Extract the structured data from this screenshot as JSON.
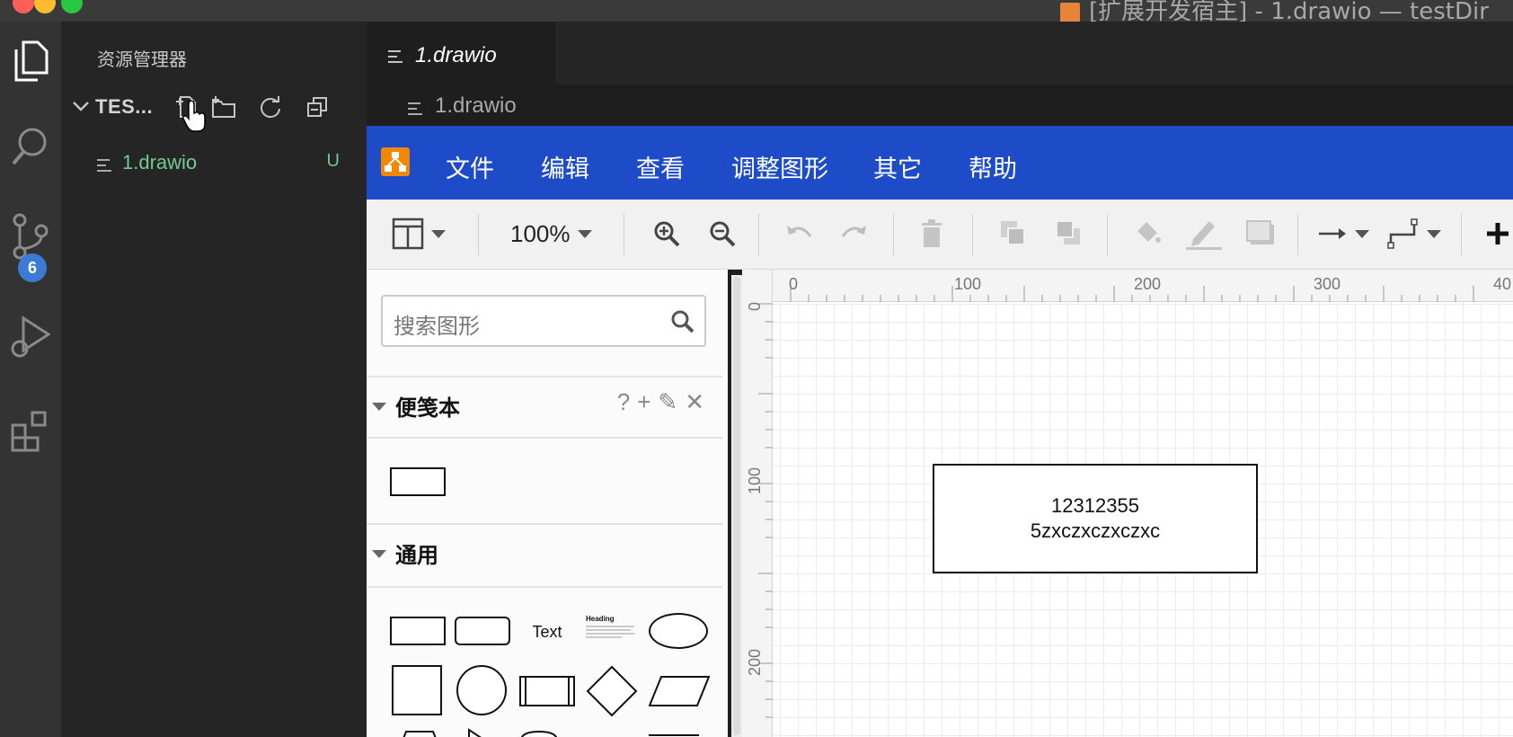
{
  "window": {
    "title": "[扩展开发宿主] - 1.drawio — testDir"
  },
  "activity_bar": {
    "scm_badge": "6"
  },
  "explorer": {
    "title": "资源管理器",
    "folder": "TES...",
    "files": [
      {
        "name": "1.drawio",
        "status": "U"
      }
    ]
  },
  "editor": {
    "active_tab": "1.drawio",
    "breadcrumb": "1.drawio"
  },
  "drawio": {
    "menu": [
      "文件",
      "编辑",
      "查看",
      "调整图形",
      "其它",
      "帮助"
    ],
    "zoom": "100%",
    "search_placeholder": "搜索图形",
    "sections": {
      "scratchpad": "便笺本",
      "general": "通用"
    },
    "scratchpad_tools": [
      "?",
      "+",
      "✎",
      "✕"
    ],
    "shape_labels": {
      "text": "Text",
      "heading": "Heading"
    },
    "ruler_top": [
      "0",
      "100",
      "200",
      "300",
      "40"
    ],
    "ruler_left": [
      "0",
      "100",
      "200"
    ],
    "diagram": {
      "line1": "12312355",
      "line2": "5zxczxczxczxc"
    }
  },
  "colors": {
    "accent_blue": "#1e4bc7",
    "untracked_green": "#73c991",
    "badge_blue": "#3b7bd4"
  }
}
